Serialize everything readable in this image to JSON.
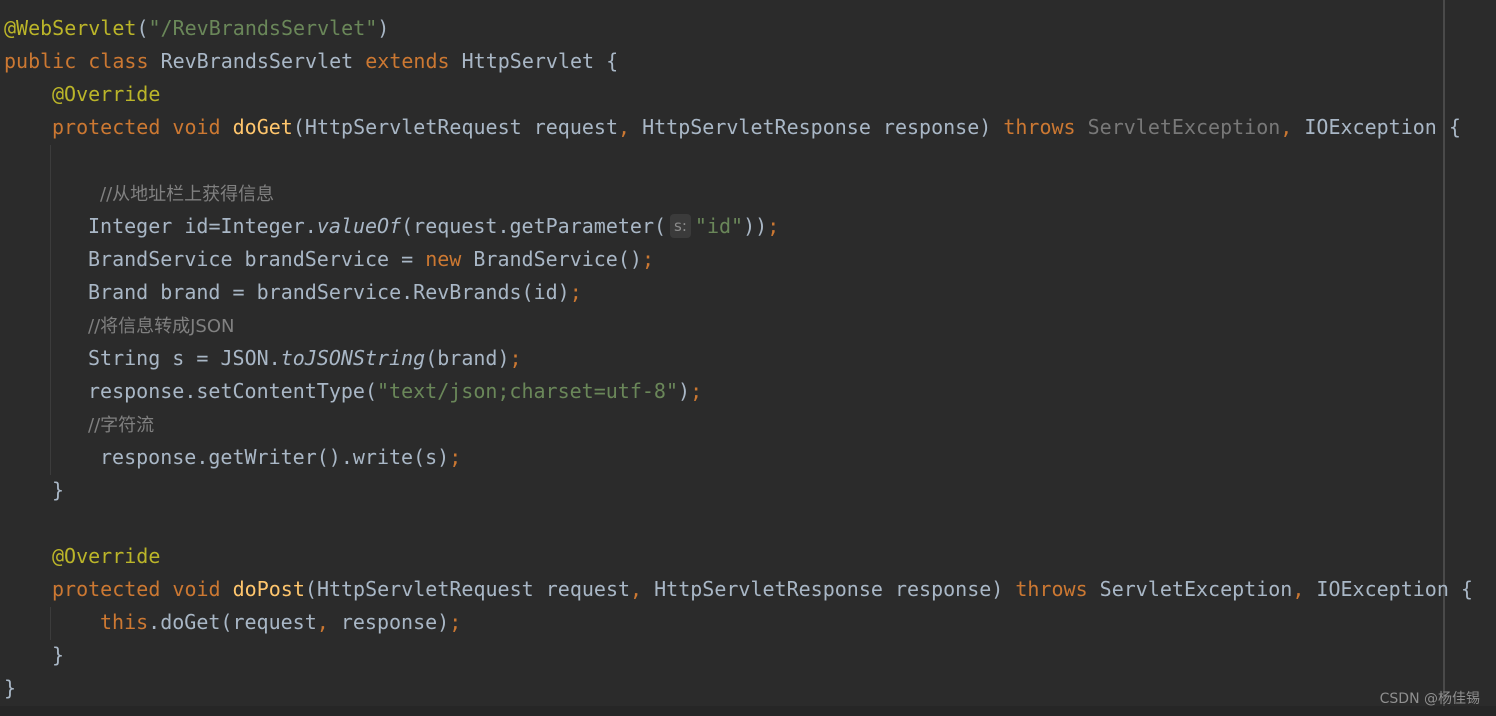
{
  "editor": {
    "annotation_webservlet": "@WebServlet",
    "servlet_path": "\"/RevBrandsServlet\"",
    "annotation_override": "@Override",
    "kw_public": "public",
    "kw_class": "class",
    "class_name": "RevBrandsServlet",
    "kw_extends": "extends",
    "super_class": "HttpServlet",
    "kw_protected": "protected",
    "kw_void": "void",
    "method_doget": "doGet",
    "method_dopost": "doPost",
    "param_req_type": "HttpServletRequest",
    "param_req": "request",
    "param_resp_type": "HttpServletResponse",
    "param_resp": "response",
    "kw_throws": "throws",
    "ex_servlet": "ServletException",
    "ex_io": "IOException",
    "comment_1": "//从地址栏上获得信息",
    "comment_2": "//将信息转成JSON",
    "comment_3": "//字符流",
    "hint_s": "s:",
    "str_id": "\"id\"",
    "str_content_type": "\"text/json;charset=utf-8\"",
    "kw_new": "new",
    "kw_this": "this",
    "m_valueof": "valueOf",
    "m_tojsonstring": "toJSONString",
    "t_integer": "Integer",
    "t_brandservice": "BrandService",
    "t_brand": "Brand",
    "t_string": "String",
    "t_json": "JSON",
    "v_id": "id",
    "v_brandservice": "brandService",
    "v_brand": "brand",
    "v_s": "s",
    "m_getparameter": "request.getParameter(",
    "m_revbrands": "brandService.RevBrands(id)",
    "m_setcontenttype": "response.setContentType(",
    "m_getwriter": "response.getWriter().write(s)",
    "m_dogetcall": ".doGet(request",
    "m_dogetcall_end": " response)"
  },
  "watermark": "CSDN @杨佳锡"
}
